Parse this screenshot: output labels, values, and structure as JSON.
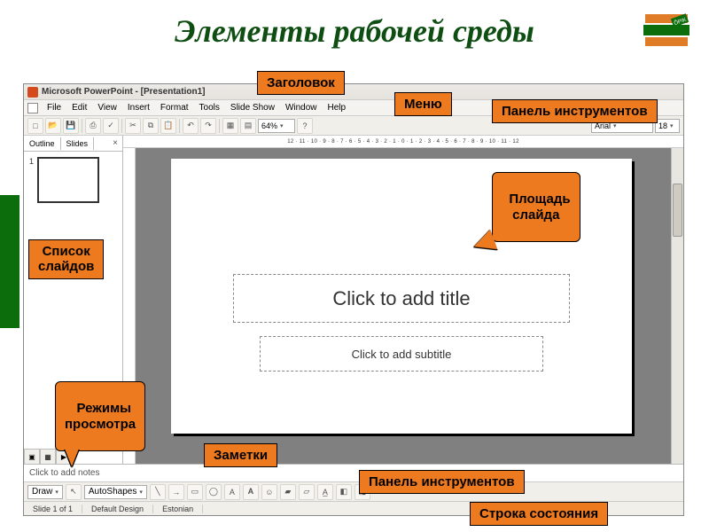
{
  "lecture": {
    "title": "Элементы рабочей среды"
  },
  "window": {
    "app_title": "Microsoft PowerPoint - [Presentation1]"
  },
  "menu": {
    "items": [
      "File",
      "Edit",
      "View",
      "Insert",
      "Format",
      "Tools",
      "Slide Show",
      "Window",
      "Help"
    ]
  },
  "toolbar_top": {
    "zoom": "64%",
    "font_name": "Arial",
    "font_size": "18"
  },
  "left_pane": {
    "tabs": [
      "Outline",
      "Slides"
    ],
    "close": "×",
    "slide_number": "1"
  },
  "ruler_text": "12 · 11 · 10 · 9 · 8 · 7 · 6 · 5 · 4 · 3 · 2 · 1 · 0 · 1 · 2 · 3 · 4 · 5 · 6 · 7 · 8 · 9 · 10 · 11 · 12",
  "slide": {
    "title_placeholder": "Click to add title",
    "subtitle_placeholder": "Click to add subtitle"
  },
  "notes": {
    "placeholder": "Click to add notes"
  },
  "draw_toolbar": {
    "draw": "Draw",
    "autoshapes": "AutoShapes"
  },
  "status": {
    "slide": "Slide 1 of 1",
    "design": "Default Design",
    "lang": "Estonian"
  },
  "callouts": {
    "title": "Заголовок",
    "menu": "Меню",
    "toolbar_top": "Панель инструментов",
    "slide_list": "Список\nслайдов",
    "slide_area": "Площадь\nслайда",
    "view_modes": "Режимы\nпросмотра",
    "notes": "Заметки",
    "toolbar_bottom": "Панель инструментов",
    "status": "Строка состояния"
  }
}
